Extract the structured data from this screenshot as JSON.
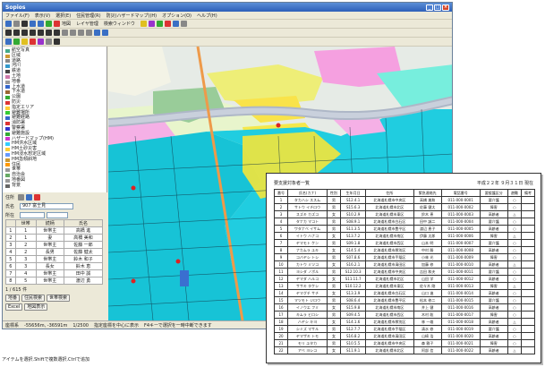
{
  "window": {
    "title": "Sopios"
  },
  "menu": [
    "ファイル(F)",
    "表示(V)",
    "選択(E)",
    "住民管理(R)",
    "防災(ハザードマップ)(H)",
    "オプション(O)",
    "ヘルプ(H)"
  ],
  "toolbar": {
    "labels": [
      "地図",
      "レイヤ管理",
      "検索ウィンドウ"
    ]
  },
  "tree": [
    {
      "label": "航空写真",
      "color": "#4a8"
    },
    {
      "label": "区域",
      "color": "#c93"
    },
    {
      "label": "道路",
      "color": "#888"
    },
    {
      "label": "河川",
      "color": "#39c"
    },
    {
      "label": "鉄道",
      "color": "#444"
    },
    {
      "label": "土地",
      "color": "#c7a"
    },
    {
      "label": "地番",
      "color": "#999"
    },
    {
      "label": "上水道",
      "color": "#36c"
    },
    {
      "label": "下水道",
      "color": "#963"
    },
    {
      "label": "公園",
      "color": "#3a3"
    },
    {
      "label": "防災",
      "color": "#d33"
    },
    {
      "label": "指定エリア",
      "color": "#fc3"
    },
    {
      "label": "避難場所",
      "color": "#3c3"
    },
    {
      "label": "避難経路",
      "color": "#36c"
    },
    {
      "label": "消防署",
      "color": "#d33"
    },
    {
      "label": "警察署",
      "color": "#33c"
    },
    {
      "label": "避難施設",
      "color": "#3a3"
    },
    {
      "label": "ハザードマップ(HM)",
      "color": "#c3c"
    },
    {
      "label": "HM洪水区域",
      "color": "#3cf"
    },
    {
      "label": "HM土砂災害",
      "color": "#fc3"
    },
    {
      "label": "HM浸水想定区域",
      "color": "#69f"
    },
    {
      "label": "HM急傾斜地",
      "color": "#c93"
    },
    {
      "label": "住民",
      "color": "#f90"
    },
    {
      "label": "世帯",
      "color": "#999"
    },
    {
      "label": "自治会",
      "color": "#6a6"
    },
    {
      "label": "地番図",
      "color": "#999"
    },
    {
      "label": "背景",
      "color": "#666"
    }
  ],
  "panel": {
    "search_label": "住所",
    "name_label": "氏名",
    "name_value": "907 富士見",
    "area_label": "所在",
    "columns": [
      "",
      "世帯",
      "続柄",
      "氏名"
    ],
    "rows": [
      [
        "1",
        "1",
        "世帯主",
        "高橋 進"
      ],
      [
        "2",
        "1",
        "妻",
        "高橋 美和"
      ],
      [
        "3",
        "2",
        "世帯主",
        "佐藤 一郎"
      ],
      [
        "4",
        "2",
        "長男",
        "佐藤 健太"
      ],
      [
        "5",
        "3",
        "世帯主",
        "鈴木 和子"
      ],
      [
        "6",
        "3",
        "長女",
        "鈴木 恵"
      ],
      [
        "7",
        "4",
        "世帯主",
        "田中 誠"
      ],
      [
        "8",
        "5",
        "世帯主",
        "渡辺 勇"
      ]
    ],
    "count": "1 / 615 件",
    "tabs": [
      "地番",
      "住民検索",
      "世帯検索"
    ],
    "excel_btn": "Excel",
    "map_btn": "地図表示"
  },
  "status": {
    "mode": "座標系",
    "coords": "-55656m, -36591m",
    "scale": "1/2500",
    "msg": "指定座標を中心に表示",
    "hint": "F4キーで選択を一時中断できます",
    "left_hint": "アイテムを選択.Shiftで複数選択.Ctrlで追加"
  },
  "sheet": {
    "title": "要支援対象者一覧",
    "date": "平成２２年 ９月３１日 現在",
    "headers": [
      "番号",
      "氏名(カナ)",
      "性別",
      "生年月日",
      "住所",
      "緊急連絡先",
      "電話番号",
      "要援護区分",
      "避難",
      "備考"
    ],
    "rows": [
      [
        "1",
        "タカハシ ススム",
        "男",
        "S12.4.1",
        "北海道札幌市中央区",
        "高橋 美和",
        "011-000-0001",
        "要介護",
        "○",
        ""
      ],
      [
        "2",
        "サトウ イチロウ",
        "男",
        "S15.6.3",
        "北海道札幌市北区",
        "佐藤 健太",
        "011-000-0002",
        "障害",
        "○",
        ""
      ],
      [
        "3",
        "スズキ カズコ",
        "女",
        "S10.2.9",
        "北海道札幌市東区",
        "鈴木 恵",
        "011-000-0003",
        "高齢者",
        "△",
        ""
      ],
      [
        "4",
        "タナカ マコト",
        "男",
        "S08.9.1",
        "北海道札幌市白石区",
        "田中 誠二",
        "011-000-0004",
        "要介護",
        "○",
        ""
      ],
      [
        "5",
        "ワタナベ イサム",
        "男",
        "S11.3.5",
        "北海道札幌市豊平区",
        "渡辺 恵子",
        "011-000-0005",
        "高齢者",
        "○",
        ""
      ],
      [
        "6",
        "イトウ ハナコ",
        "女",
        "S13.7.2",
        "北海道札幌市南区",
        "伊藤 太郎",
        "011-000-0006",
        "障害",
        "△",
        ""
      ],
      [
        "7",
        "ヤマモト ケン",
        "男",
        "S09.1.8",
        "北海道札幌市西区",
        "山本 明",
        "011-000-0007",
        "要介護",
        "○",
        ""
      ],
      [
        "8",
        "ナカムラ ユキ",
        "女",
        "S14.5.4",
        "北海道札幌市厚別区",
        "中村 勝",
        "011-000-0008",
        "高齢者",
        "○",
        ""
      ],
      [
        "9",
        "コバヤシ トシ",
        "男",
        "S07.8.6",
        "北海道札幌市手稲区",
        "小林 光",
        "011-000-0009",
        "障害",
        "○",
        ""
      ],
      [
        "10",
        "カトウ ミツコ",
        "女",
        "S16.2.1",
        "北海道札幌市清田区",
        "加藤 修",
        "011-000-0010",
        "高齢者",
        "△",
        ""
      ],
      [
        "11",
        "ヨシダ ノボル",
        "男",
        "S12.10.3",
        "北海道札幌市中央区",
        "吉田 和夫",
        "011-000-0011",
        "要介護",
        "○",
        ""
      ],
      [
        "12",
        "ヤマダ ハルコ",
        "女",
        "S11.11.7",
        "北海道札幌市北区",
        "山田 学",
        "011-000-0012",
        "高齢者",
        "○",
        ""
      ],
      [
        "13",
        "ササキ タケシ",
        "男",
        "S10.12.2",
        "北海道札幌市東区",
        "佐々木 剛",
        "011-000-0013",
        "障害",
        "△",
        ""
      ],
      [
        "14",
        "ヤマグチ サチ",
        "女",
        "S13.3.9",
        "北海道札幌市白石区",
        "山口 進",
        "011-000-0014",
        "高齢者",
        "○",
        ""
      ],
      [
        "15",
        "マツモト ジロウ",
        "男",
        "S08.6.4",
        "北海道札幌市豊平区",
        "松本 修二",
        "011-000-0015",
        "要介護",
        "○",
        ""
      ],
      [
        "16",
        "イノウエ フミ",
        "女",
        "S15.9.8",
        "北海道札幌市南区",
        "井上 健",
        "011-000-0016",
        "高齢者",
        "○",
        ""
      ],
      [
        "17",
        "キムラ ヒロシ",
        "男",
        "S09.4.5",
        "北海道札幌市西区",
        "木村 聡",
        "011-000-0017",
        "障害",
        "○",
        ""
      ],
      [
        "18",
        "ハヤシ キヨ",
        "女",
        "S14.1.6",
        "北海道札幌市厚別区",
        "林 一雄",
        "011-000-0018",
        "高齢者",
        "△",
        ""
      ],
      [
        "19",
        "シミズ マサル",
        "男",
        "S12.7.7",
        "北海道札幌市手稲区",
        "清水 修",
        "011-000-0019",
        "要介護",
        "○",
        ""
      ],
      [
        "20",
        "ヤマザキ トモ",
        "女",
        "S16.8.2",
        "北海道札幌市清田区",
        "山崎 浩",
        "011-000-0020",
        "高齢者",
        "○",
        ""
      ],
      [
        "21",
        "モリ ユタカ",
        "男",
        "S10.5.5",
        "北海道札幌市中央区",
        "森 雅子",
        "011-000-0021",
        "障害",
        "○",
        ""
      ],
      [
        "22",
        "アベ ヨシコ",
        "女",
        "S11.9.1",
        "北海道札幌市北区",
        "阿部 信",
        "011-000-0022",
        "高齢者",
        "△",
        ""
      ]
    ]
  }
}
